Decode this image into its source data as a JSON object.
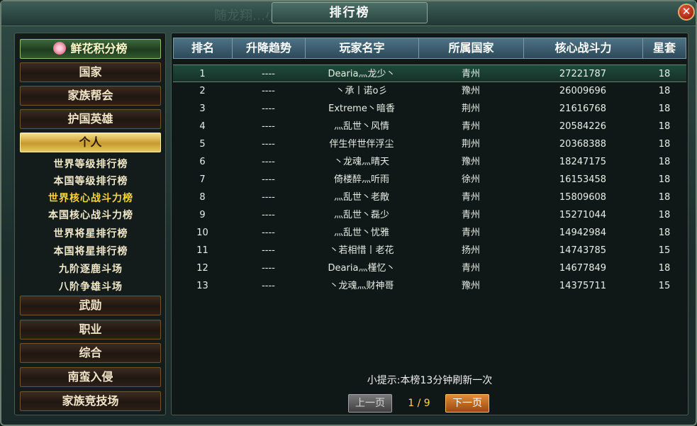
{
  "window": {
    "title": "排行榜",
    "ghost_text": "随龙翔…小北孙…击败入侵者!",
    "close_icon": "close-icon"
  },
  "sidebar": {
    "flower_button": "鲜花积分榜",
    "buttons_top": [
      "国家",
      "家族帮会",
      "护国英雄",
      "个人"
    ],
    "sub_items": [
      "世界等级排行榜",
      "本国等级排行榜",
      "世界核心战斗力榜",
      "本国核心战斗力榜",
      "世界将星排行榜",
      "本国将星排行榜",
      "九阶逐鹿斗场",
      "八阶争雄斗场"
    ],
    "buttons_bottom": [
      "武勋",
      "职业",
      "综合",
      "南蛮入侵",
      "家族竞技场"
    ],
    "active_button": "个人",
    "active_sub_item": "世界核心战斗力榜"
  },
  "table": {
    "headers": [
      "排名",
      "升降趋势",
      "玩家名字",
      "所属国家",
      "核心战斗力",
      "星套"
    ],
    "rows": [
      [
        "1",
        "----",
        "Dearia灬龙少丶",
        "青州",
        "27221787",
        "18"
      ],
      [
        "2",
        "----",
        "丶承丨诺o彡",
        "豫州",
        "26009696",
        "18"
      ],
      [
        "3",
        "----",
        "Extreme丶暗香",
        "荆州",
        "21616768",
        "18"
      ],
      [
        "4",
        "----",
        "灬乱世丶风情",
        "青州",
        "20584226",
        "18"
      ],
      [
        "5",
        "----",
        "伴生伴世伴浮尘",
        "荆州",
        "20368388",
        "18"
      ],
      [
        "6",
        "----",
        "丶龙魂灬晴天",
        "豫州",
        "18247175",
        "18"
      ],
      [
        "7",
        "----",
        "倚楼醉灬听雨",
        "徐州",
        "16153458",
        "18"
      ],
      [
        "8",
        "----",
        "灬乱世丶老敵",
        "青州",
        "15809608",
        "18"
      ],
      [
        "9",
        "----",
        "灬乱世丶磊少",
        "青州",
        "15271044",
        "18"
      ],
      [
        "10",
        "----",
        "灬乱世丶忧雅",
        "青州",
        "14942984",
        "18"
      ],
      [
        "11",
        "----",
        "丶若相惜丨老花",
        "扬州",
        "14743785",
        "15"
      ],
      [
        "12",
        "----",
        "Dearia灬槿忆丶",
        "青州",
        "14677849",
        "18"
      ],
      [
        "13",
        "----",
        "丶龙魂灬财神哥",
        "豫州",
        "14375711",
        "15"
      ]
    ],
    "selected_row": 0
  },
  "footer": {
    "hint": "小提示:本榜13分钟刷新一次",
    "prev_label": "上一页",
    "next_label": "下一页",
    "page_indicator": "1 / 9"
  },
  "colors": {
    "accent_gold": "#ffd23a",
    "selected_row": "#1f4a3c",
    "header_blue": "#4e7286"
  }
}
